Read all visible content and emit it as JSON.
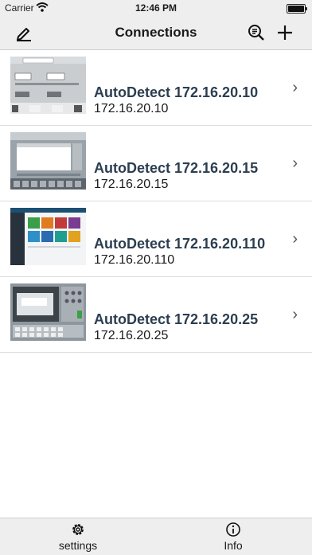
{
  "status_bar": {
    "carrier": "Carrier",
    "time": "12:46 PM"
  },
  "nav": {
    "title": "Connections",
    "icons": [
      "edit-icon",
      "search-list-icon",
      "plus-icon"
    ]
  },
  "connections": [
    {
      "name": "AutoDetect 172.16.20.10",
      "ip": "172.16.20.10",
      "thumb_theme": "hmi-basic"
    },
    {
      "name": "AutoDetect 172.16.20.15",
      "ip": "172.16.20.15",
      "thumb_theme": "hmi-dialog"
    },
    {
      "name": "AutoDetect 172.16.20.110",
      "ip": "172.16.20.110",
      "thumb_theme": "hmi-tiles"
    },
    {
      "name": "AutoDetect 172.16.20.25",
      "ip": "172.16.20.25",
      "thumb_theme": "hmi-keypad"
    }
  ],
  "tabs": [
    {
      "label": "settings",
      "icon": "gear-icon"
    },
    {
      "label": "Info",
      "icon": "info-icon"
    }
  ]
}
